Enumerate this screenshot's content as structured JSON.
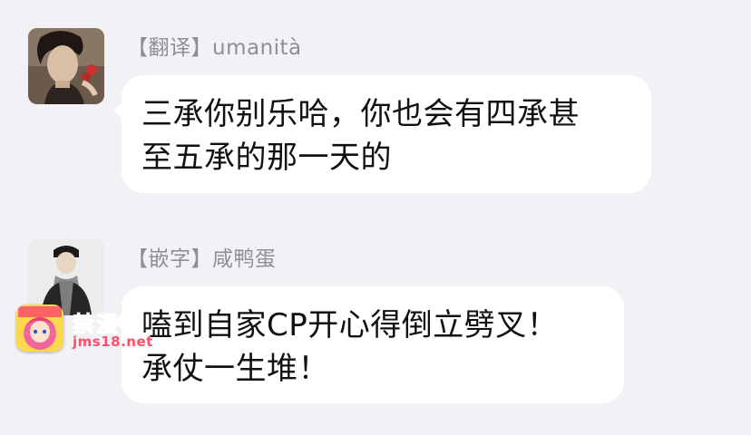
{
  "messages": [
    {
      "sender": "【翻译】umanità",
      "lines": [
        "三承你别乐哈，你也会有四承甚",
        "至五承的那一天的"
      ]
    },
    {
      "sender": "【嵌字】咸鸭蛋",
      "lines": [
        "嗑到自家CP开心得倒立劈叉！",
        "承仗一生堆！"
      ]
    }
  ],
  "watermark": {
    "title": "禁漫社",
    "url": "jms18.net"
  }
}
